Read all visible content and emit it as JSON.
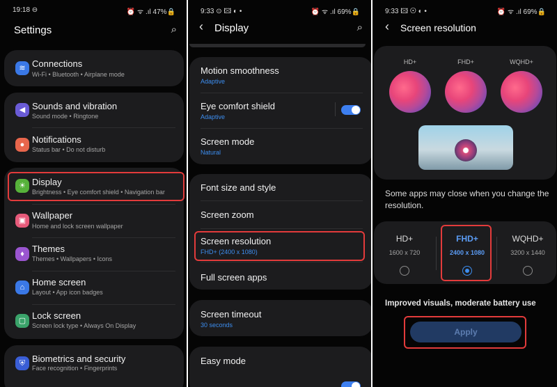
{
  "p1": {
    "status": {
      "time": "19:18 ⊖",
      "icons": "⏰ ᯤ .ıl 47%🔒"
    },
    "title": "Settings",
    "items": [
      {
        "label": "Connections",
        "sub": "Wi-Fi  •  Bluetooth  •  Airplane mode",
        "icon": "wifi-icon",
        "color": "#3a78e6",
        "glyph": "≋"
      },
      {
        "label": "Sounds and vibration",
        "sub": "Sound mode  •  Ringtone",
        "icon": "volume-icon",
        "color": "#6a5bd6",
        "glyph": "◀"
      },
      {
        "label": "Notifications",
        "sub": "Status bar  •  Do not disturb",
        "icon": "bell-icon",
        "color": "#e8664c",
        "glyph": "●"
      },
      {
        "label": "Display",
        "sub": "Brightness  •  Eye comfort shield  •  Navigation bar",
        "icon": "sun-icon",
        "color": "#56b23a",
        "glyph": "☀"
      },
      {
        "label": "Wallpaper",
        "sub": "Home and lock screen wallpaper",
        "icon": "image-icon",
        "color": "#e65a7a",
        "glyph": "▣"
      },
      {
        "label": "Themes",
        "sub": "Themes  •  Wallpapers  •  Icons",
        "icon": "brush-icon",
        "color": "#9a55d0",
        "glyph": "♦"
      },
      {
        "label": "Home screen",
        "sub": "Layout  •  App icon badges",
        "icon": "home-icon",
        "color": "#3a78e6",
        "glyph": "⌂"
      },
      {
        "label": "Lock screen",
        "sub": "Screen lock type  •  Always On Display",
        "icon": "lock-icon",
        "color": "#3aa36a",
        "glyph": "🔒"
      },
      {
        "label": "Biometrics and security",
        "sub": "Face recognition  •  Fingerprints",
        "icon": "shield-icon",
        "color": "#3a5ed6",
        "glyph": "⛨"
      }
    ]
  },
  "p2": {
    "status": {
      "time": "9:33 ⊙ 🖾 ◐  •",
      "icons": "⏰ ᯤ .ıl 69%🔒"
    },
    "title": "Display",
    "items": [
      {
        "label": "Motion smoothness",
        "sub": "Adaptive"
      },
      {
        "label": "Eye comfort shield",
        "sub": "Adaptive"
      },
      {
        "label": "Screen mode",
        "sub": "Natural"
      },
      {
        "label": "Font size and style"
      },
      {
        "label": "Screen zoom"
      },
      {
        "label": "Screen resolution",
        "sub": "FHD+ (2400 x 1080)"
      },
      {
        "label": "Full screen apps"
      },
      {
        "label": "Screen timeout",
        "sub": "30 seconds"
      },
      {
        "label": "Easy mode"
      }
    ]
  },
  "p3": {
    "status": {
      "time": "9:33 🖾 ⊙ ◐  •",
      "icons": "⏰ ᯤ .ıl 69%🔒"
    },
    "title": "Screen resolution",
    "thumbs": [
      "HD+",
      "FHD+",
      "WQHD+"
    ],
    "notice": "Some apps may close when you change the resolution.",
    "options": [
      {
        "name": "HD+",
        "res": "1600 x 720",
        "selected": false
      },
      {
        "name": "FHD+",
        "res": "2400 x 1080",
        "selected": true
      },
      {
        "name": "WQHD+",
        "res": "3200 x 1440",
        "selected": false
      }
    ],
    "summary": "Improved visuals, moderate battery use",
    "apply": "Apply"
  }
}
